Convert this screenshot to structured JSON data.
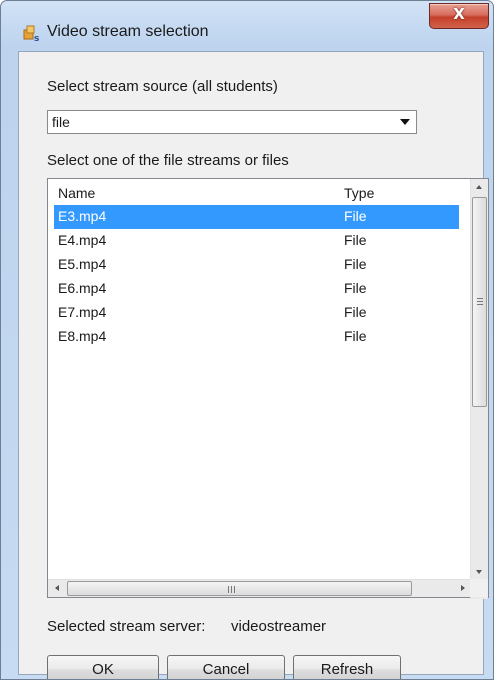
{
  "window": {
    "title": "Video stream selection",
    "close_glyph": "X"
  },
  "source": {
    "label": "Select stream source (all students)",
    "selected": "file"
  },
  "files": {
    "label": "Select one of the file streams or files",
    "columns": [
      "Name",
      "Type"
    ],
    "rows": [
      {
        "name": "E3.mp4",
        "type": "File",
        "selected": true
      },
      {
        "name": "E4.mp4",
        "type": "File",
        "selected": false
      },
      {
        "name": "E5.mp4",
        "type": "File",
        "selected": false
      },
      {
        "name": "E6.mp4",
        "type": "File",
        "selected": false
      },
      {
        "name": "E7.mp4",
        "type": "File",
        "selected": false
      },
      {
        "name": "E8.mp4",
        "type": "File",
        "selected": false
      }
    ]
  },
  "server": {
    "label": "Selected stream server:",
    "value": "videostreamer"
  },
  "buttons": {
    "ok": "OK",
    "cancel": "Cancel",
    "refresh": "Refresh"
  },
  "colors": {
    "selection": "#3399ff",
    "close": "#c4402b"
  },
  "icons": {
    "app": "video-stream-app-icon",
    "close": "close-icon",
    "dropdown": "chevron-down-icon"
  }
}
